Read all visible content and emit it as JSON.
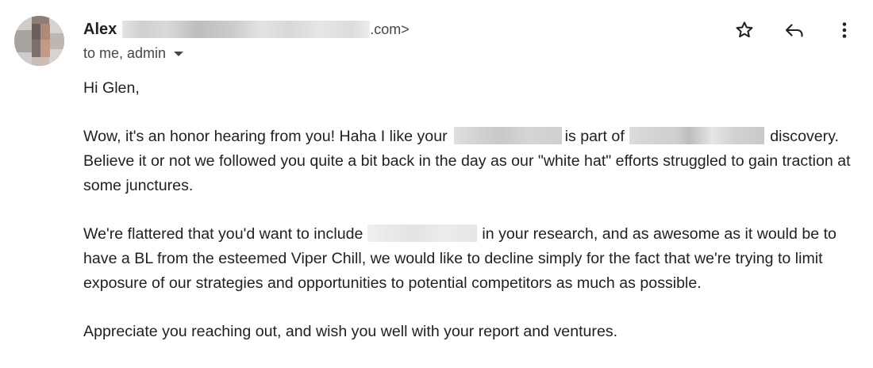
{
  "header": {
    "sender_name": "Alex",
    "sender_email_suffix": ".com>",
    "recipients": "to me, admin",
    "avatar_icon": "contact-avatar",
    "actions": [
      {
        "name": "star-button",
        "icon": "star-icon"
      },
      {
        "name": "reply-button",
        "icon": "reply-icon"
      },
      {
        "name": "more-options-button",
        "icon": "more-vert-icon"
      }
    ]
  },
  "body": {
    "greeting": "Hi Glen,",
    "p1": {
      "a": "Wow, it's an honor hearing from you! Haha I like your",
      "b": "is part of",
      "c": "discovery. Believe it or not we followed you quite a bit back in the day as our \"white hat\" efforts struggled to gain traction at some junctures."
    },
    "p2": {
      "a": "We're flattered that you'd want to include",
      "b": "in your research, and as awesome as it would be to have a BL from the esteemed Viper Chill, we would like to decline simply for the fact that we're trying to limit exposure of our strategies and opportunities to potential competitors as much as possible."
    },
    "p3": "Appreciate you reaching out, and wish you well with your report and ventures."
  },
  "colors": {
    "text": "#202124",
    "secondary_text": "#444746",
    "background": "#ffffff",
    "redaction": "#d3d3d3"
  }
}
